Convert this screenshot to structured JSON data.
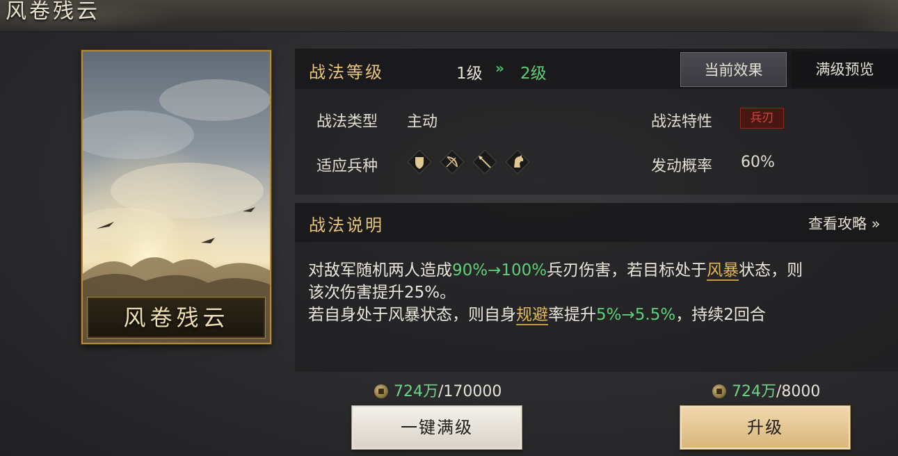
{
  "header": {
    "title": "风卷残云"
  },
  "card": {
    "name": "风卷残云"
  },
  "level": {
    "title": "战法等级",
    "from": "1级",
    "arrow": "»",
    "to": "2级"
  },
  "tabs": [
    {
      "label": "当前效果",
      "active": true
    },
    {
      "label": "满级预览",
      "active": false
    }
  ],
  "attributes": {
    "type_label": "战法类型",
    "type_value": "主动",
    "trait_label": "战法特性",
    "trait_value": "兵刃",
    "units_label": "适应兵种",
    "units": [
      "shield-infantry-icon",
      "bow-archer-icon",
      "spear-icon",
      "horse-cavalry-icon"
    ],
    "chance_label": "发动概率",
    "chance_value": "60%"
  },
  "description": {
    "title": "战法说明",
    "guide_link": "查看攻略 »",
    "line1": {
      "a": "对敌军随机两人造成",
      "b": "90%→100%",
      "c": "兵刃伤害，若目标处于",
      "d": "风暴",
      "e": "状态，则"
    },
    "line2": "该次伤害提升25%。",
    "line3": {
      "a": "若自身处于风暴状态，则自身",
      "b": "规避",
      "c": "率提升",
      "d": "5%→5.5%",
      "e": "，持续2回合"
    }
  },
  "costs": {
    "max": {
      "have": "724万",
      "need": "/170000"
    },
    "upgrade": {
      "have": "724万",
      "need": "/8000"
    }
  },
  "buttons": {
    "max_label": "一键满级",
    "upgrade_label": "升级"
  },
  "colors": {
    "accent_gold": "#e7c47a",
    "green": "#5fd07a",
    "trait_red": "#d7453b"
  }
}
